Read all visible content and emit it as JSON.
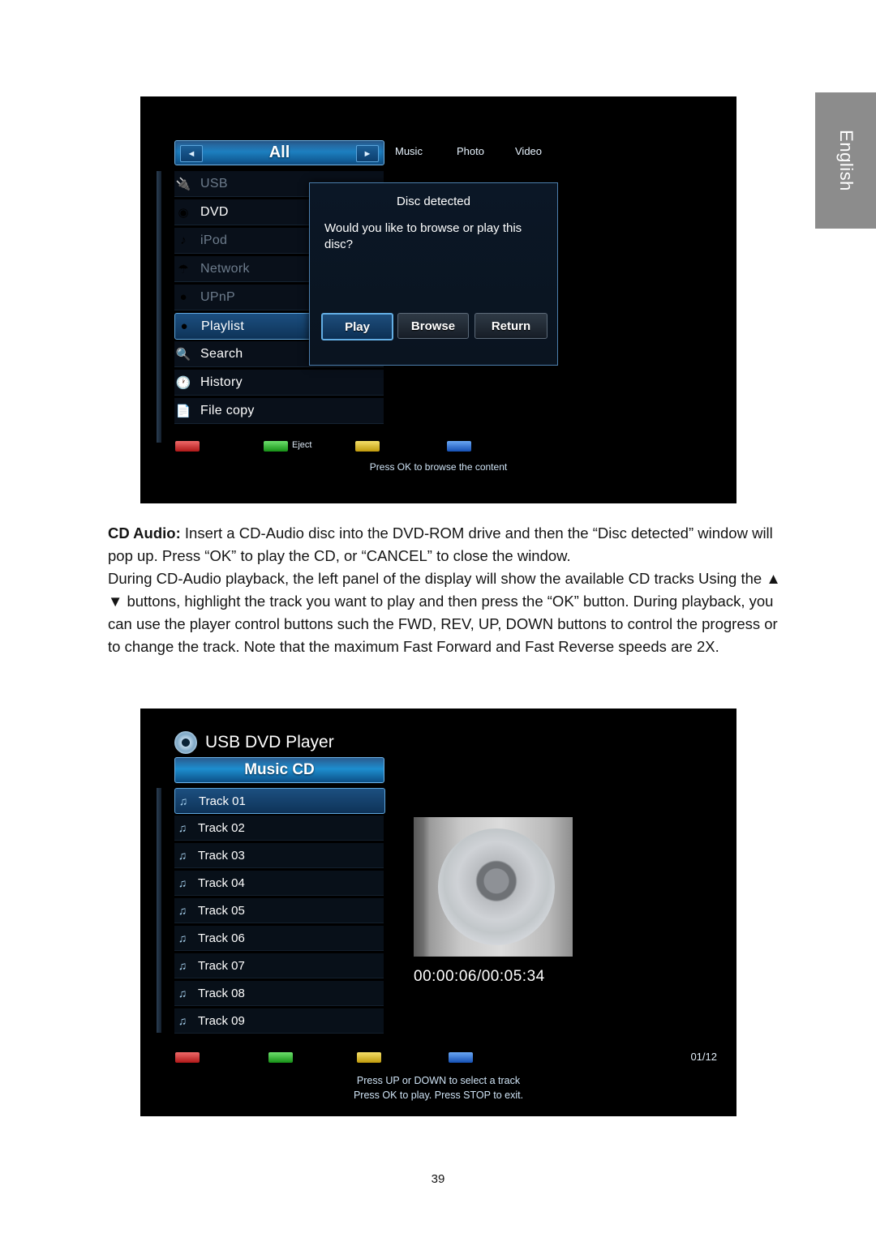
{
  "page": {
    "language_tab": "English",
    "page_number": "39"
  },
  "screen_one": {
    "tab_selected": "All",
    "arrow_left": "◄",
    "arrow_right": "►",
    "top_menu": [
      "Music",
      "Photo",
      "Video"
    ],
    "sources": [
      {
        "label": "USB",
        "icon": "usb-icon",
        "state": "dim"
      },
      {
        "label": "DVD",
        "icon": "disc-icon",
        "state": "bright"
      },
      {
        "label": "iPod",
        "icon": "music-note-icon",
        "state": "dim"
      },
      {
        "label": "Network",
        "icon": "network-icon",
        "state": "dim"
      },
      {
        "label": "UPnP",
        "icon": "upnp-icon",
        "state": "dim"
      },
      {
        "label": "Playlist",
        "icon": "playlist-icon",
        "state": "selected"
      },
      {
        "label": "Search",
        "icon": "search-icon",
        "state": "bright"
      },
      {
        "label": "History",
        "icon": "history-icon",
        "state": "bright"
      },
      {
        "label": "File copy",
        "icon": "file-copy-icon",
        "state": "bright"
      }
    ],
    "dialog": {
      "title": "Disc detected",
      "message": "Would you like to browse or play this disc?",
      "buttons": [
        "Play",
        "Browse",
        "Return"
      ]
    },
    "color_keys": [
      {
        "color": "#c21a1a",
        "label": ""
      },
      {
        "color": "#17901a",
        "label": "Eject"
      },
      {
        "color": "#c4a00d",
        "label": ""
      },
      {
        "color": "#1a56bb",
        "label": ""
      }
    ],
    "hint": "Press OK to browse the content"
  },
  "body_text": {
    "lead_label": "CD Audio:",
    "paragraph_one": " Insert a CD-Audio disc into the DVD-ROM drive and then the “Disc detected” window will pop up.  Press “OK” to play the CD, or “CANCEL” to close the window.",
    "paragraph_two": "During CD-Audio playback, the left panel of the display will show the available CD tracks Using the ▲ ▼ buttons, highlight the track you want to play and then press the “OK” button. During playback, you can use the player control buttons such the FWD, REV, UP, DOWN buttons to control the progress or to change the track. Note that the maximum Fast Forward and Fast Reverse speeds are 2X."
  },
  "screen_two": {
    "app_title": "USB DVD Player",
    "disc_label": "Music CD",
    "tracks": [
      "Track 01",
      "Track 02",
      "Track 03",
      "Track 04",
      "Track 05",
      "Track 06",
      "Track 07",
      "Track 08",
      "Track 09"
    ],
    "selected_track_index": 0,
    "timecode": "00:00:06/00:05:34",
    "track_counter": "01/12",
    "color_keys": [
      {
        "color": "#c21a1a",
        "label": ""
      },
      {
        "color": "#17901a",
        "label": ""
      },
      {
        "color": "#c4a00d",
        "label": ""
      },
      {
        "color": "#1a56bb",
        "label": ""
      }
    ],
    "hint_line_one": "Press UP or DOWN to select a track",
    "hint_line_two": "Press OK to play. Press STOP to exit."
  }
}
